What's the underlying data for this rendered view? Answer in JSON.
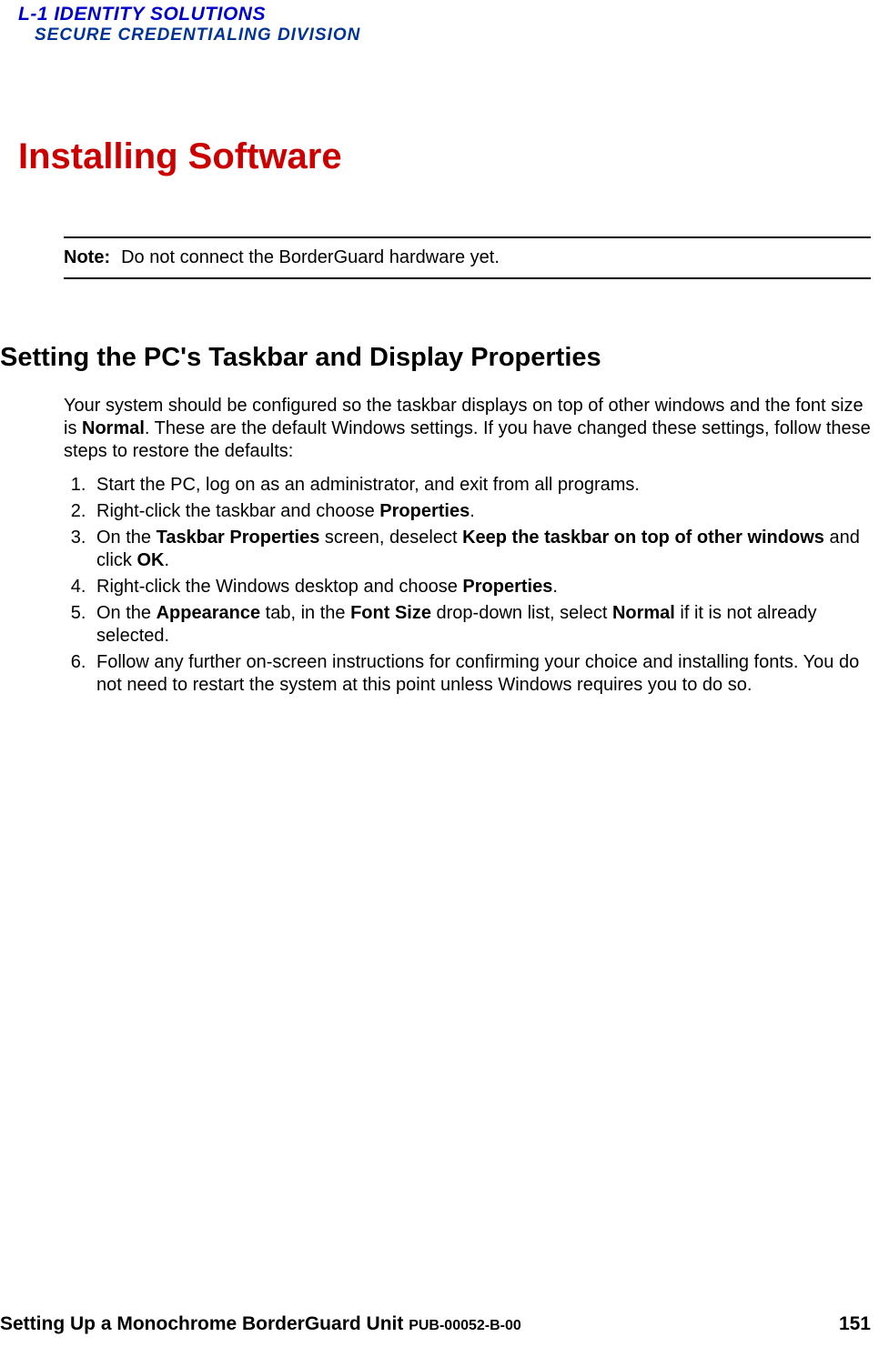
{
  "header": {
    "logo_line1": "L-1 IDENTITY SOLUTIONS",
    "logo_line2": "SECURE CREDENTIALING DIVISION"
  },
  "main_title": "Installing Software",
  "note": {
    "label": "Note:",
    "text": "Do not connect the BorderGuard hardware yet."
  },
  "section_title": "Setting the PC's Taskbar and Display Properties",
  "intro": {
    "part1": "Your system should be configured so the taskbar displays on top of other windows and the font size is ",
    "bold1": "Normal",
    "part2": ". These are the default Windows settings. If you have changed these settings, follow these steps to restore the defaults:"
  },
  "steps": {
    "s1": "Start the PC, log on as an administrator, and exit from all programs.",
    "s2_a": "Right-click the taskbar and choose ",
    "s2_b": "Properties",
    "s2_c": ".",
    "s3_a": "On the ",
    "s3_b": "Taskbar Properties",
    "s3_c": " screen, deselect ",
    "s3_d": "Keep the taskbar on top of other windows",
    "s3_e": " and click ",
    "s3_f": "OK",
    "s3_g": ".",
    "s4_a": "Right-click the Windows desktop and choose ",
    "s4_b": "Properties",
    "s4_c": ".",
    "s5_a": "On the ",
    "s5_b": "Appearance",
    "s5_c": " tab, in the ",
    "s5_d": "Font Size",
    "s5_e": " drop-down list, select ",
    "s5_f": "Normal",
    "s5_g": " if it is not already selected.",
    "s6": "Follow any further on-screen instructions for confirming your choice and installing fonts. You do not need to restart the system at this point unless Windows requires you to do so."
  },
  "footer": {
    "title": "Setting Up a Monochrome BorderGuard Unit ",
    "pub": "PUB-00052-B-00",
    "page": "151"
  }
}
